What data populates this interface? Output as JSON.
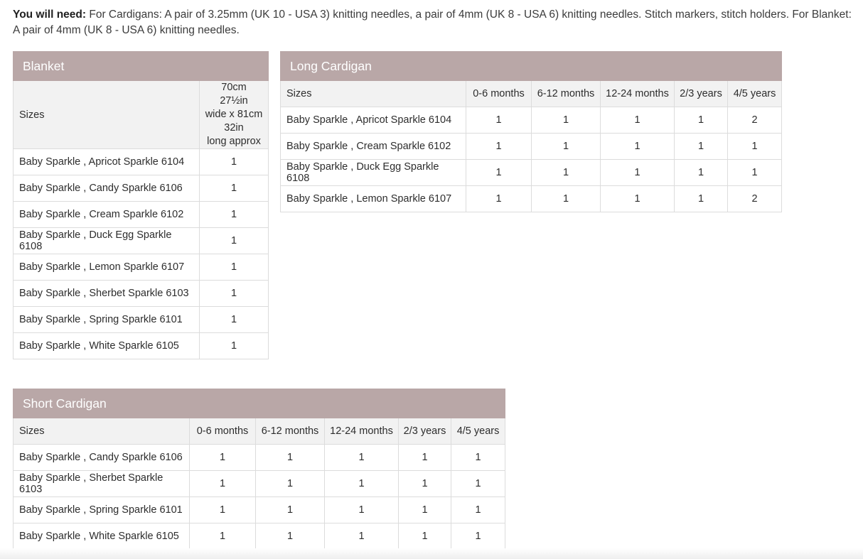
{
  "intro": {
    "lead": "You will need:",
    "text": " For Cardigans: A pair of 3.25mm (UK 10 - USA 3) knitting needles, a pair of 4mm (UK 8 - USA 6) knitting needles. Stitch markers, stitch holders. For Blanket: A pair of 4mm (UK 8 - USA 6) knitting needles."
  },
  "colors": {
    "caption_background": "#b9a7a7",
    "header_background": "#f2f2f2",
    "border": "#dcdcdc"
  },
  "blanket": {
    "title": "Blanket",
    "sizes_label": "Sizes",
    "size_lines": [
      "70cm",
      "27½in",
      "wide x 81cm",
      "32in",
      "long approx"
    ],
    "rows": [
      {
        "yarn": "Baby Sparkle , Apricot Sparkle 6104",
        "qty": "1"
      },
      {
        "yarn": "Baby Sparkle , Candy Sparkle 6106",
        "qty": "1"
      },
      {
        "yarn": "Baby Sparkle , Cream Sparkle 6102",
        "qty": "1"
      },
      {
        "yarn": "Baby Sparkle , Duck Egg Sparkle 6108",
        "qty": "1"
      },
      {
        "yarn": "Baby Sparkle , Lemon Sparkle 6107",
        "qty": "1"
      },
      {
        "yarn": "Baby Sparkle , Sherbet Sparkle 6103",
        "qty": "1"
      },
      {
        "yarn": "Baby Sparkle , Spring Sparkle 6101",
        "qty": "1"
      },
      {
        "yarn": "Baby Sparkle , White Sparkle 6105",
        "qty": "1"
      }
    ]
  },
  "long_cardigan": {
    "title": "Long Cardigan",
    "sizes_label": "Sizes",
    "columns": [
      "0-6 months",
      "6-12 months",
      "12-24 months",
      "2/3 years",
      "4/5 years"
    ],
    "rows": [
      {
        "yarn": "Baby Sparkle , Apricot Sparkle 6104",
        "qty": [
          "1",
          "1",
          "1",
          "1",
          "2"
        ]
      },
      {
        "yarn": "Baby Sparkle , Cream Sparkle 6102",
        "qty": [
          "1",
          "1",
          "1",
          "1",
          "1"
        ]
      },
      {
        "yarn": "Baby Sparkle , Duck Egg Sparkle 6108",
        "qty": [
          "1",
          "1",
          "1",
          "1",
          "1"
        ]
      },
      {
        "yarn": "Baby Sparkle , Lemon Sparkle 6107",
        "qty": [
          "1",
          "1",
          "1",
          "1",
          "2"
        ]
      }
    ]
  },
  "short_cardigan": {
    "title": "Short Cardigan",
    "sizes_label": "Sizes",
    "columns": [
      "0-6 months",
      "6-12 months",
      "12-24 months",
      "2/3 years",
      "4/5 years"
    ],
    "rows": [
      {
        "yarn": "Baby Sparkle , Candy Sparkle 6106",
        "qty": [
          "1",
          "1",
          "1",
          "1",
          "1"
        ]
      },
      {
        "yarn": "Baby Sparkle , Sherbet Sparkle 6103",
        "qty": [
          "1",
          "1",
          "1",
          "1",
          "1"
        ]
      },
      {
        "yarn": "Baby Sparkle , Spring Sparkle 6101",
        "qty": [
          "1",
          "1",
          "1",
          "1",
          "1"
        ]
      },
      {
        "yarn": "Baby Sparkle , White Sparkle 6105",
        "qty": [
          "1",
          "1",
          "1",
          "1",
          "1"
        ]
      }
    ]
  }
}
